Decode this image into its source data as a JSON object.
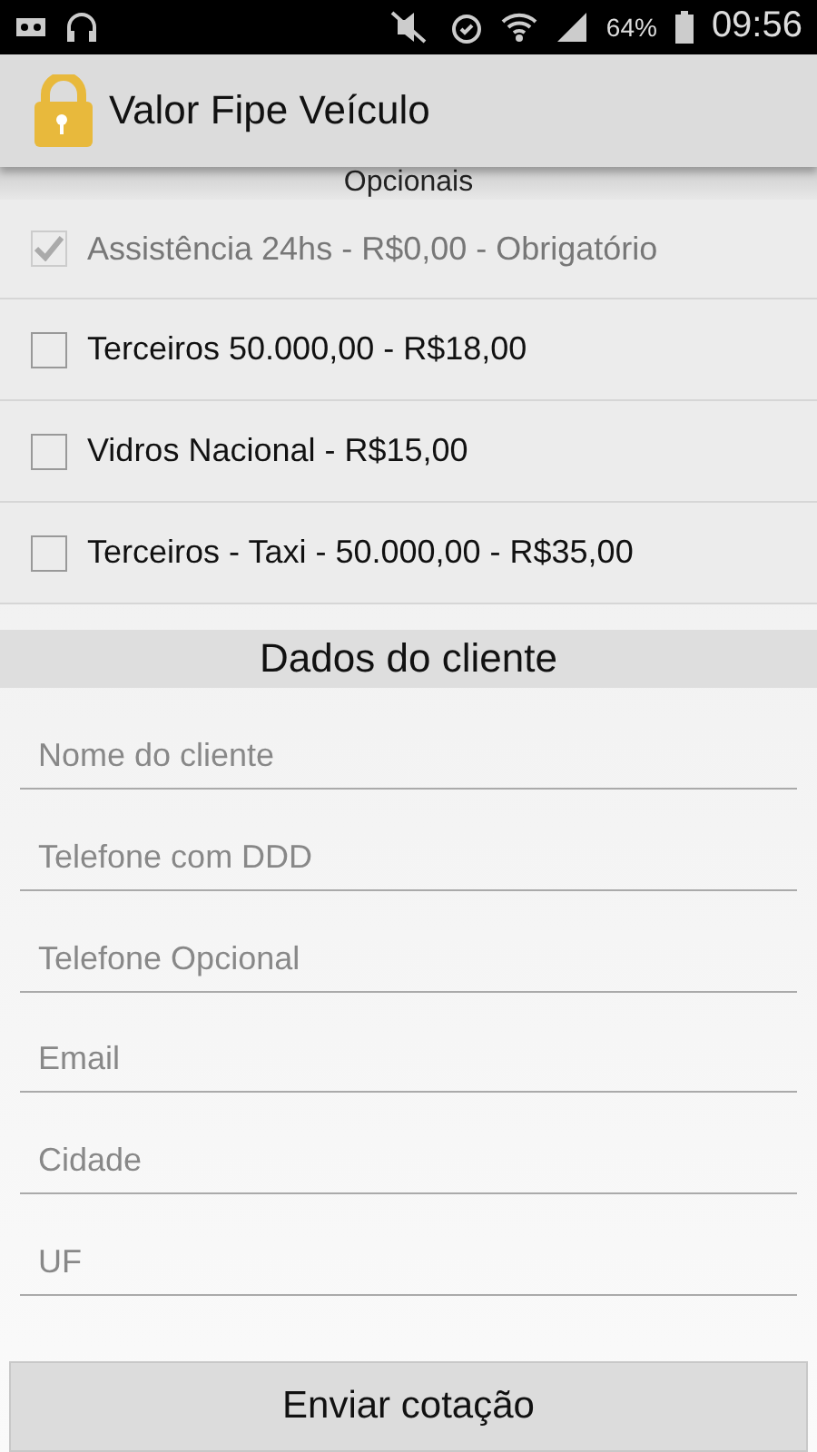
{
  "status_bar": {
    "battery": "64%",
    "time": "09:56"
  },
  "app_bar": {
    "title": "Valor Fipe Veículo"
  },
  "optionals": {
    "title": "Opcionais",
    "items": [
      {
        "label": "Assistência 24hs - R$0,00 - Obrigatório",
        "checked": true,
        "disabled": true
      },
      {
        "label": "Terceiros 50.000,00 - R$18,00",
        "checked": false,
        "disabled": false
      },
      {
        "label": "Vidros Nacional - R$15,00",
        "checked": false,
        "disabled": false
      },
      {
        "label": "Terceiros - Taxi - 50.000,00 - R$35,00",
        "checked": false,
        "disabled": false
      }
    ]
  },
  "client": {
    "title": "Dados do cliente",
    "fields": [
      {
        "placeholder": "Nome do cliente"
      },
      {
        "placeholder": "Telefone com DDD"
      },
      {
        "placeholder": "Telefone Opcional"
      },
      {
        "placeholder": "Email"
      },
      {
        "placeholder": "Cidade"
      },
      {
        "placeholder": "UF"
      }
    ]
  },
  "submit": "Enviar cotação"
}
